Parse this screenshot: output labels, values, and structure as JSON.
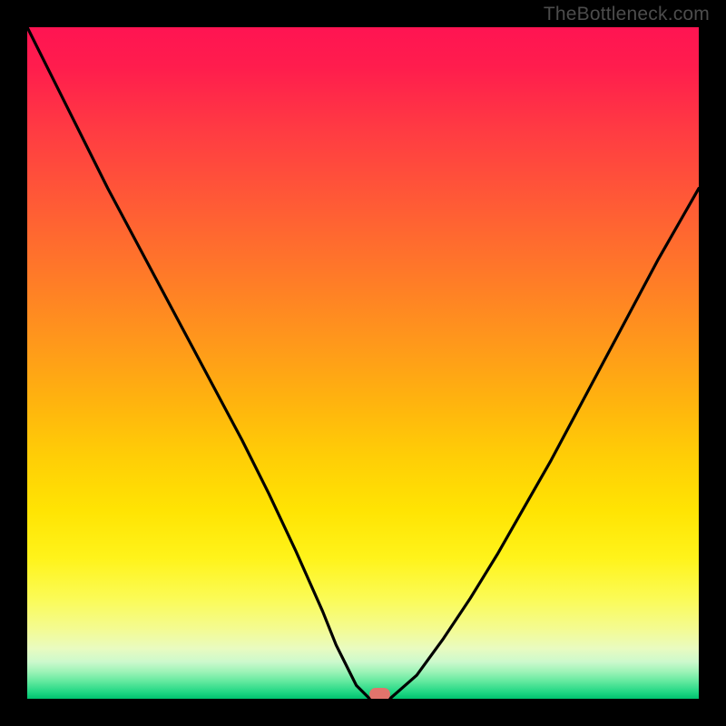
{
  "watermark": "TheBottleneck.com",
  "chart_data": {
    "type": "line",
    "title": "",
    "xlabel": "",
    "ylabel": "",
    "xlim": [
      0,
      100
    ],
    "ylim": [
      0,
      100
    ],
    "grid": false,
    "series": [
      {
        "name": "curve",
        "x": [
          0,
          4,
          8,
          12,
          16,
          20,
          24,
          28,
          32,
          36,
          40,
          44,
          46,
          49,
          51,
          54,
          58,
          62,
          66,
          70,
          74,
          78,
          82,
          86,
          90,
          94,
          98,
          100
        ],
        "values": [
          100,
          92,
          84,
          76,
          68.5,
          61,
          53.5,
          46,
          38.5,
          30.5,
          22,
          13,
          8,
          2,
          0,
          0,
          3.5,
          9,
          15,
          21.5,
          28.5,
          35.5,
          43,
          50.5,
          58,
          65.5,
          72.5,
          76
        ]
      }
    ],
    "marker": {
      "x_center": 52.5,
      "y": 0.7,
      "width": 3.2,
      "height": 1.9
    },
    "colors": {
      "curve": "#000000",
      "marker": "#e2746c",
      "background_top": "#ff1452",
      "background_bottom": "#00c26f",
      "frame": "#000000"
    }
  }
}
